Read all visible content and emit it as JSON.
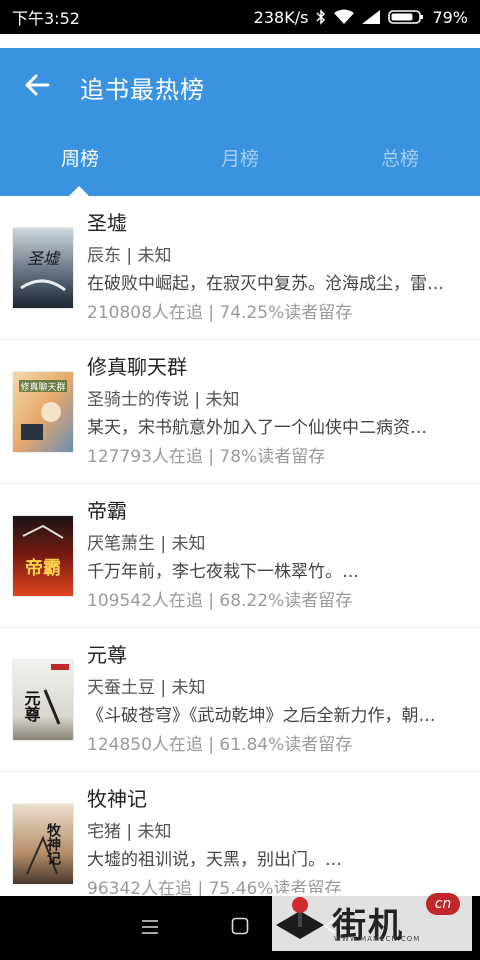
{
  "status": {
    "time": "下午3:52",
    "speed": "238K/s",
    "battery": "79%"
  },
  "header": {
    "title": "追书最热榜",
    "back_icon": "arrow-left-icon"
  },
  "tabs": [
    {
      "label": "周榜",
      "active": true
    },
    {
      "label": "月榜",
      "active": false
    },
    {
      "label": "总榜",
      "active": false
    }
  ],
  "books": [
    {
      "title": "圣墟",
      "meta": "辰东 | 未知",
      "desc": "在破败中崛起，在寂灭中复苏。沧海成尘，雷…",
      "stats": "210808人在追 |  74.25%读者留存",
      "cover_text": "圣墟"
    },
    {
      "title": "修真聊天群",
      "meta": "圣骑士的传说 | 未知",
      "desc": "某天，宋书航意外加入了一个仙侠中二病资…",
      "stats": "127793人在追 |  78%读者留存",
      "cover_text": "修真聊天群"
    },
    {
      "title": "帝霸",
      "meta": "厌笔萧生 | 未知",
      "desc": "千万年前，李七夜栽下一株翠竹。…",
      "stats": "109542人在追 |  68.22%读者留存",
      "cover_text": "帝霸"
    },
    {
      "title": "元尊",
      "meta": "天蚕土豆 | 未知",
      "desc": "《斗破苍穹》《武动乾坤》之后全新力作，朝…",
      "stats": "124850人在追 |  61.84%读者留存",
      "cover_text": "元尊"
    },
    {
      "title": "牧神记",
      "meta": "宅猪 | 未知",
      "desc": "大墟的祖训说，天黑，别出门。…",
      "stats": "96342人在追 |  75.46%读者留存",
      "cover_text": "牧神记"
    }
  ],
  "watermark": {
    "text": "街机",
    "url": "WWW.MAMECN.COM",
    "badge": "cn"
  },
  "colors": {
    "primary": "#3a93e0",
    "text_dark": "#222222",
    "text_muted": "#9a9a9a"
  }
}
